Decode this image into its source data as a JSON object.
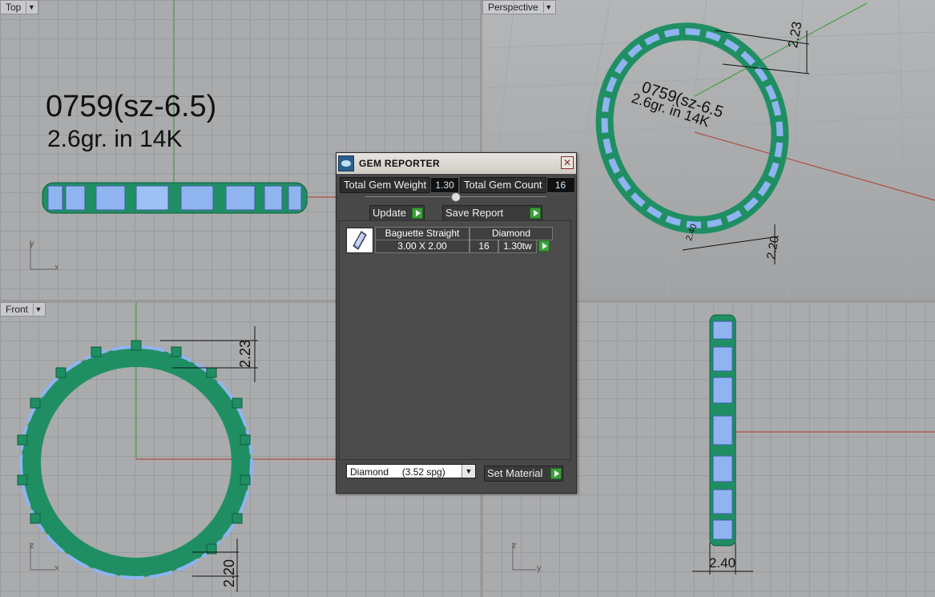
{
  "viewports": {
    "top": {
      "label": "Top",
      "line1": "0759(sz-6.5)",
      "line2": "2.6gr.  in 14K",
      "axis_v": "y",
      "axis_h": "x"
    },
    "perspective": {
      "label": "Perspective",
      "line1": "0759(sz-6.5",
      "line2": "2.6gr.  in 14K",
      "dim_top": "2.23",
      "dim_bottom_a": "2.40",
      "dim_bottom_b": "2.20"
    },
    "front": {
      "label": "Front",
      "dim_top": "2.23",
      "dim_bottom": "2.20",
      "axis_v": "z",
      "axis_h": "x"
    },
    "right": {
      "dim_bottom": "2.40",
      "axis_v": "z",
      "axis_h": "y"
    }
  },
  "dialog": {
    "title": "GEM REPORTER",
    "total_weight_label": "Total Gem Weight",
    "total_weight_value": "1.30",
    "total_count_label": "Total Gem Count",
    "total_count_value": "16",
    "update_label": "Update",
    "save_report_label": "Save Report",
    "gems": [
      {
        "shape": "Baguette Straight",
        "material": "Diamond",
        "size": "3.00 X 2.00",
        "count": "16",
        "weight": "1.30tw"
      }
    ],
    "material_select": "Diamond     (3.52 spg)",
    "set_material_label": "Set Material"
  },
  "colors": {
    "ring_green": "#1f8f63",
    "gem_blue": "#8fb4f0",
    "axis_red": "#b03a2e",
    "axis_green": "#3b9a3b"
  }
}
